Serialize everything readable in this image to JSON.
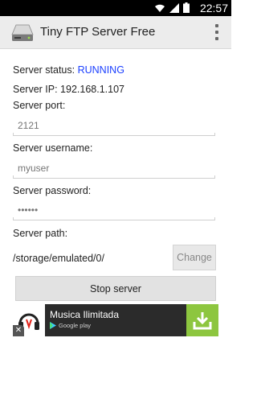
{
  "status_bar": {
    "time": "22:57",
    "icons": [
      "wifi-icon",
      "signal-icon",
      "battery-icon"
    ]
  },
  "app_bar": {
    "title": "Tiny FTP Server Free",
    "app_icon": "ftp-server-icon",
    "menu_icon": "overflow-menu-icon"
  },
  "server": {
    "status_label": "Server status: ",
    "status_value": "RUNNING",
    "status_color": "#1a3fff",
    "ip_label": "Server IP: 192.168.1.107",
    "port_label": "Server port:",
    "port_value": "2121",
    "username_label": "Server username:",
    "username_value": "myuser",
    "password_label": "Server password:",
    "password_value": "••••••",
    "path_label": "Server path:",
    "path_value": "/storage/emulated/0/",
    "change_button": "Change",
    "stop_button": "Stop server"
  },
  "ad": {
    "title": "Musica Ilimitada",
    "store": "Google play",
    "close_glyph": "✕",
    "download_color": "#8dc63f"
  }
}
